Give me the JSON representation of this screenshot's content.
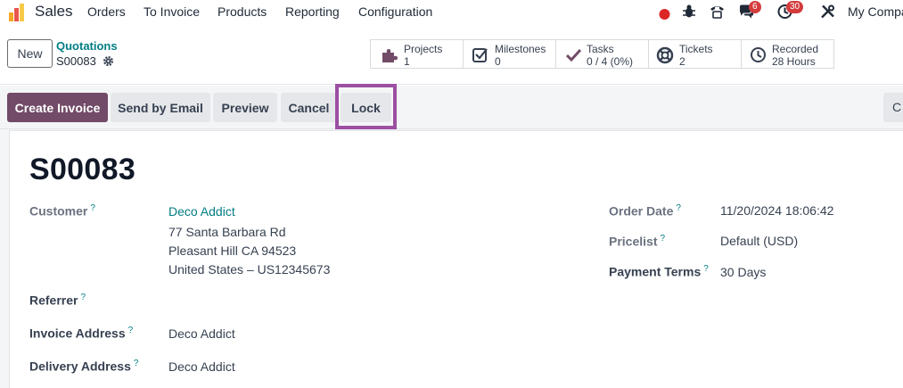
{
  "navbar": {
    "app_name": "Sales",
    "menu": [
      "Orders",
      "To Invoice",
      "Products",
      "Reporting",
      "Configuration"
    ],
    "chat_badge": "6",
    "activity_badge": "30",
    "company": "My Compa"
  },
  "control": {
    "new_label": "New",
    "breadcrumb_parent": "Quotations",
    "breadcrumb_current": "S00083",
    "smart_buttons": [
      {
        "label": "Projects",
        "value": "1",
        "icon": "puzzle-icon"
      },
      {
        "label": "Milestones",
        "value": "0",
        "icon": "checkbox-icon"
      },
      {
        "label": "Tasks",
        "value": "0 / 4 (0%)",
        "icon": "check-icon"
      },
      {
        "label": "Tickets",
        "value": "2",
        "icon": "lifebuoy-icon"
      },
      {
        "label": "Recorded",
        "value": "28 Hours",
        "icon": "clock-icon"
      }
    ]
  },
  "actions": {
    "create_invoice": "Create Invoice",
    "send_by_email": "Send by Email",
    "preview": "Preview",
    "cancel": "Cancel",
    "lock": "Lock",
    "overflow": "C"
  },
  "form": {
    "title": "S00083",
    "customer_label": "Customer",
    "customer_name": "Deco Addict",
    "customer_address_1": "77 Santa Barbara Rd",
    "customer_address_2": "Pleasant Hill CA 94523",
    "customer_address_3": "United States – US12345673",
    "referrer_label": "Referrer",
    "invoice_address_label": "Invoice Address",
    "invoice_address_value": "Deco Addict",
    "delivery_address_label": "Delivery Address",
    "delivery_address_value": "Deco Addict",
    "order_date_label": "Order Date",
    "order_date_value": "11/20/2024 18:06:42",
    "pricelist_label": "Pricelist",
    "pricelist_value": "Default (USD)",
    "payment_terms_label": "Payment Terms",
    "payment_terms_value": "30 Days",
    "help_mark": "?"
  },
  "colors": {
    "brand": "#714b67",
    "link": "#017e84",
    "highlight": "#9c4fa3",
    "badge": "#d43c3c"
  }
}
